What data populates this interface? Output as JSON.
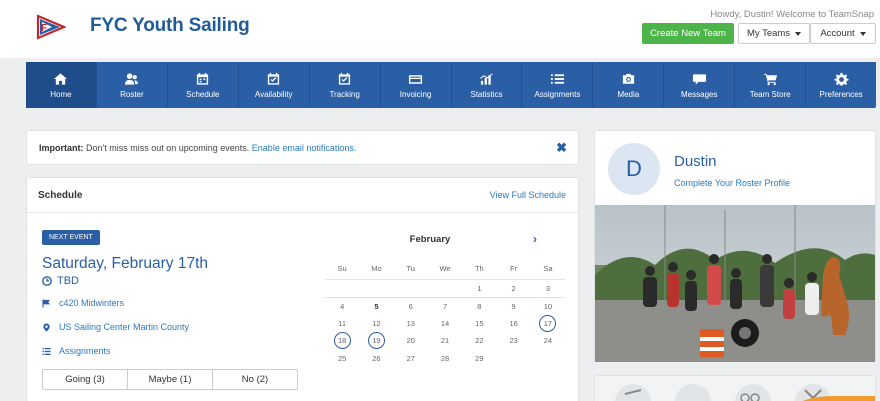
{
  "header": {
    "brand": "FYC Youth Sailing",
    "greeting": "Howdy, Dustin! Welcome to TeamSnap",
    "create_team": "Create New Team",
    "my_teams": "My Teams",
    "account": "Account"
  },
  "nav": [
    {
      "label": "Home",
      "icon": "home-icon"
    },
    {
      "label": "Roster",
      "icon": "roster-icon"
    },
    {
      "label": "Schedule",
      "icon": "schedule-icon"
    },
    {
      "label": "Availability",
      "icon": "availability-icon"
    },
    {
      "label": "Tracking",
      "icon": "tracking-icon"
    },
    {
      "label": "Invoicing",
      "icon": "invoicing-icon"
    },
    {
      "label": "Statistics",
      "icon": "statistics-icon"
    },
    {
      "label": "Assignments",
      "icon": "assignments-icon"
    },
    {
      "label": "Media",
      "icon": "media-icon"
    },
    {
      "label": "Messages",
      "icon": "messages-icon"
    },
    {
      "label": "Team Store",
      "icon": "cart-icon"
    },
    {
      "label": "Preferences",
      "icon": "gear-icon"
    }
  ],
  "alert": {
    "prefix": "Important:",
    "text": " Don't miss miss out on upcoming events. ",
    "link": "Enable email notifications."
  },
  "schedule": {
    "title": "Schedule",
    "view_full": "View Full Schedule",
    "badge": "NEXT EVENT",
    "date": "Saturday, February 17th",
    "time": "TBD",
    "event_name": "c420 Midwinters",
    "location": "US Sailing Center Martin County",
    "assignments": "Assignments",
    "rsvp": [
      "Going (3)",
      "Maybe (1)",
      "No (2)"
    ]
  },
  "calendar": {
    "month": "February",
    "weekdays": [
      "Su",
      "Mo",
      "Tu",
      "We",
      "Th",
      "Fr",
      "Sa"
    ],
    "weeks": [
      [
        "",
        "",
        "",
        "",
        "1",
        "2",
        "3"
      ],
      [
        "4",
        "5",
        "6",
        "7",
        "8",
        "9",
        "10"
      ],
      [
        "11",
        "12",
        "13",
        "14",
        "15",
        "16",
        "17"
      ],
      [
        "18",
        "19",
        "20",
        "21",
        "22",
        "23",
        "24"
      ],
      [
        "25",
        "26",
        "27",
        "28",
        "29",
        "",
        ""
      ]
    ],
    "bold_day": "5",
    "circled_days": [
      "17",
      "18",
      "19"
    ]
  },
  "profile": {
    "initial": "D",
    "name": "Dustin",
    "link": "Complete Your Roster Profile"
  }
}
